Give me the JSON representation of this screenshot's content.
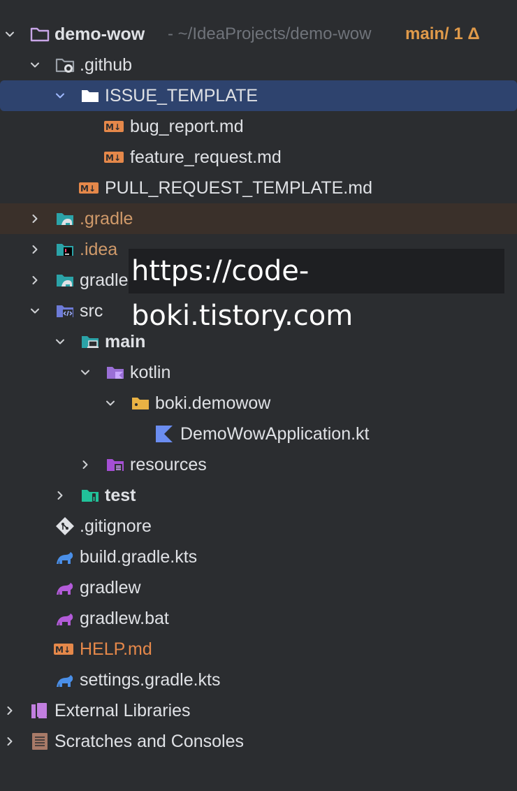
{
  "project": {
    "name": "demo-wow",
    "path_hint": "- ~/IdeaProjects/demo-wow",
    "branch": "main/ 1 Δ"
  },
  "tree": {
    "github": ".github",
    "issue_template": "ISSUE_TEMPLATE",
    "bug_report": "bug_report.md",
    "feature_request": "feature_request.md",
    "pull_request_template": "PULL_REQUEST_TEMPLATE.md",
    "gradle_hidden": ".gradle",
    "idea": ".idea",
    "gradle": "gradle",
    "src": "src",
    "main": "main",
    "kotlin": "kotlin",
    "package": "boki.demowow",
    "app_file": "DemoWowApplication.kt",
    "resources": "resources",
    "test": "test",
    "gitignore": ".gitignore",
    "build_gradle": "build.gradle.kts",
    "gradlew": "gradlew",
    "gradlew_bat": "gradlew.bat",
    "help_md": "HELP.md",
    "settings_gradle": "settings.gradle.kts",
    "external_libraries": "External Libraries",
    "scratches": "Scratches and Consoles"
  },
  "icons": {
    "project": "folder-icon",
    "github": "github-folder-icon",
    "markdown": "markdown-icon",
    "gradle_folder": "gradle-folder-icon",
    "idea_folder": "idea-folder-icon",
    "src_folder": "source-folder-icon",
    "main_folder": "main-folder-icon",
    "kotlin_folder": "kotlin-folder-icon",
    "package_folder": "package-folder-icon",
    "kotlin_file": "kotlin-file-icon",
    "resources_folder": "resources-folder-icon",
    "test_folder": "test-folder-icon",
    "git": "git-icon",
    "gradle_file": "gradle-icon",
    "library": "library-icon",
    "scratches": "scratches-icon"
  },
  "colors": {
    "background": "#2b2d30",
    "selection": "#2e436e",
    "ignored_highlight": "#3a302a",
    "branch": "#e09a4a",
    "ignored_text": "#d09a6a"
  },
  "watermark": "https://code-boki.tistory.com"
}
